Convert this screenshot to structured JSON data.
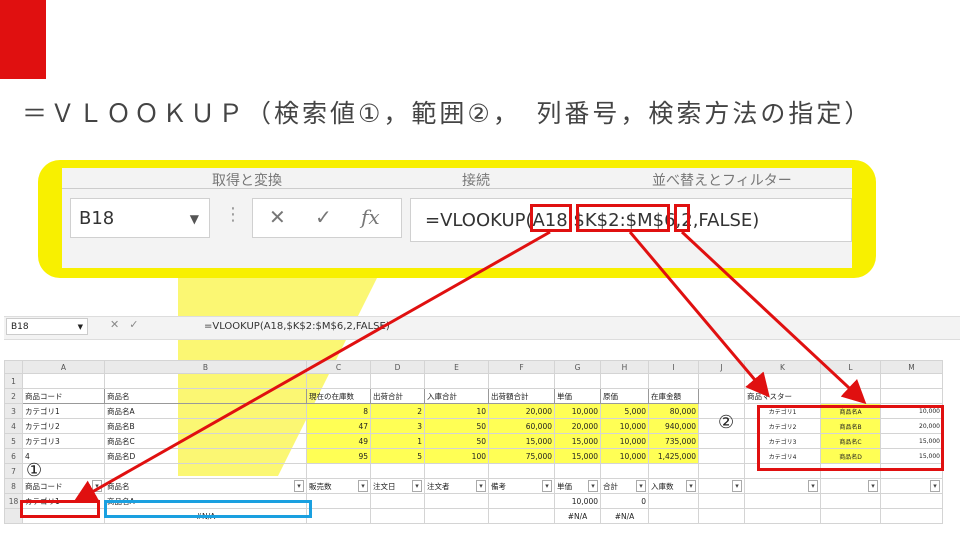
{
  "headline": "＝ＶＬＯＯＫＵＰ（検索値①，範囲②，　列番号，検索方法の指定）",
  "zoom": {
    "ribbon_tabs": [
      "取得と変換",
      "接続",
      "並べ替えとフィルター"
    ],
    "namebox": "B18",
    "formula": "=VLOOKUP(A18,$K$2:$M$6,2,FALSE)",
    "fx_label": "fx"
  },
  "sheet": {
    "namebox": "B18",
    "formula": "=VLOOKUP(A18,$K$2:$M$6,2,FALSE)",
    "columns": [
      "",
      "A",
      "B",
      "C",
      "D",
      "E",
      "F",
      "G",
      "H",
      "I",
      "J",
      "K",
      "L",
      "M"
    ],
    "rows": [
      {
        "n": "1",
        "cells": [
          "",
          "",
          "",
          "",
          "",
          "",
          "",
          "",
          "",
          "",
          "",
          "",
          ""
        ]
      },
      {
        "n": "2",
        "cells": [
          "商品コード",
          "商品名",
          "現在の在庫数",
          "出荷合計",
          "入庫合計",
          "出荷額合計",
          "単価",
          "原価",
          "在庫金額",
          "",
          "商品マスター",
          "",
          ""
        ]
      },
      {
        "n": "3",
        "cells": [
          "カテゴリ1",
          "商品名A",
          "8",
          "2",
          "10",
          "20,000",
          "10,000",
          "5,000",
          "80,000",
          "",
          "カテゴリ1",
          "商品名A",
          "10,000"
        ]
      },
      {
        "n": "4",
        "cells": [
          "カテゴリ2",
          "商品名B",
          "47",
          "3",
          "50",
          "60,000",
          "20,000",
          "10,000",
          "940,000",
          "",
          "カテゴリ2",
          "商品名B",
          "20,000"
        ]
      },
      {
        "n": "5",
        "cells": [
          "カテゴリ3",
          "商品名C",
          "49",
          "1",
          "50",
          "15,000",
          "15,000",
          "10,000",
          "735,000",
          "",
          "カテゴリ3",
          "商品名C",
          "15,000"
        ]
      },
      {
        "n": "6",
        "cells": [
          "4",
          "商品名D",
          "95",
          "5",
          "100",
          "75,000",
          "15,000",
          "10,000",
          "1,425,000",
          "",
          "カテゴリ4",
          "商品名D",
          "15,000"
        ]
      },
      {
        "n": "7",
        "cells": [
          "",
          "",
          "",
          "",
          "",
          "",
          "",
          "",
          "",
          "",
          "",
          "",
          ""
        ]
      },
      {
        "n": "8",
        "cells": [
          "商品コード",
          "商品名",
          "販売数",
          "注文日",
          "注文者",
          "備考",
          "単価",
          "合計",
          "入庫数",
          "",
          "",
          "",
          ""
        ]
      },
      {
        "n": "18",
        "cells": [
          "カテゴリ1",
          "商品名A",
          "",
          "",
          "",
          "",
          "10,000",
          "0",
          "",
          "",
          "",
          "",
          ""
        ]
      },
      {
        "n": "",
        "cells": [
          "",
          "#N/A",
          "",
          "",
          "",
          "",
          "#N/A",
          "#N/A",
          "",
          "",
          "",
          "",
          ""
        ]
      }
    ]
  },
  "markers": {
    "circle1": "①",
    "circle2": "②"
  },
  "colors": {
    "highlight": "#f8f000",
    "callout_red": "#e01010",
    "selected_blue": "#1aa0e0"
  }
}
